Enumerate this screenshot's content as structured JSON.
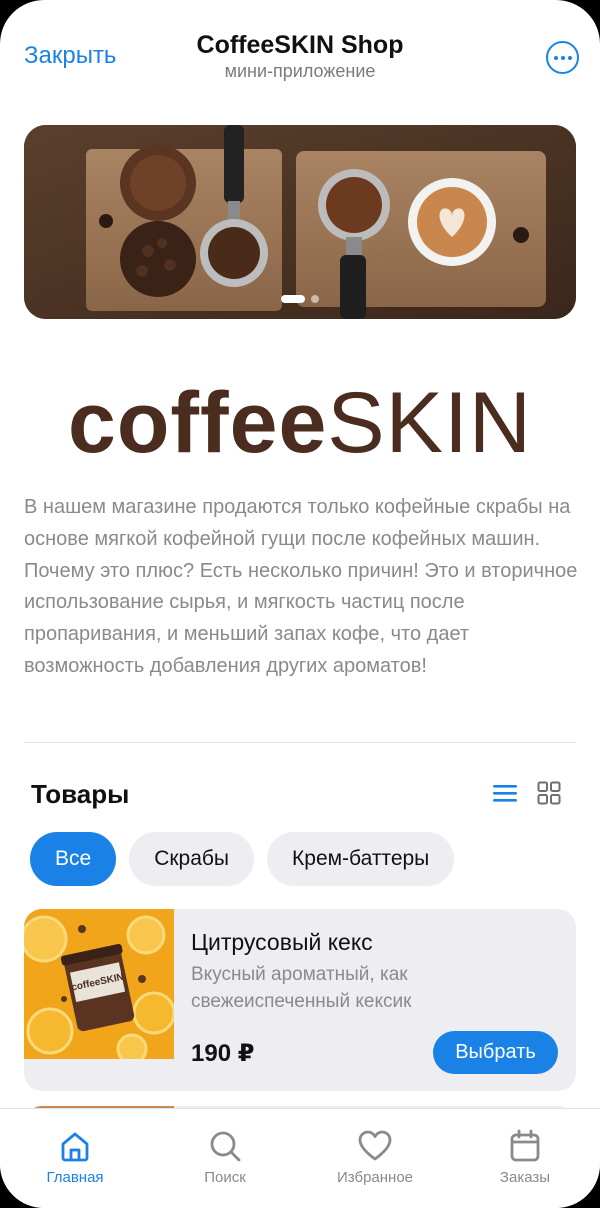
{
  "header": {
    "close_label": "Закрыть",
    "title": "CoffeeSKIN Shop",
    "subtitle": "мини-приложение"
  },
  "banner": {
    "slides": 2,
    "active_slide": 1
  },
  "logo": {
    "part1": "coffee",
    "part2": "SKIN"
  },
  "description": "В нашем магазине продаются только кофейные скрабы на основе мягкой кофейной гущи после кофейных машин. Почему это плюс? Есть несколько причин! Это и вторичное использование сырья, и мягкость частиц после пропаривания, и меньший запах кофе, что дает возможность добавления других ароматов!",
  "products_section": {
    "title": "Товары",
    "filters": [
      {
        "label": "Все",
        "active": true
      },
      {
        "label": "Скрабы",
        "active": false
      },
      {
        "label": "Крем-баттеры",
        "active": false
      }
    ],
    "items": [
      {
        "name": "Цитрусовый кекс",
        "description": "Вкусный ароматный, как свежеиспеченный кексик",
        "price": "190 ₽",
        "button_label": "Выбрать",
        "jar_label": "coffeeSKIN"
      }
    ]
  },
  "tabbar": [
    {
      "label": "Главная",
      "icon": "home-icon",
      "active": true
    },
    {
      "label": "Поиск",
      "icon": "search-icon",
      "active": false
    },
    {
      "label": "Избранное",
      "icon": "heart-icon",
      "active": false
    },
    {
      "label": "Заказы",
      "icon": "calendar-icon",
      "active": false
    }
  ],
  "colors": {
    "accent": "#1a82e6",
    "brand": "#4a2d1f",
    "chip_bg": "#eeeef2",
    "muted_text": "#8a8a8e"
  }
}
